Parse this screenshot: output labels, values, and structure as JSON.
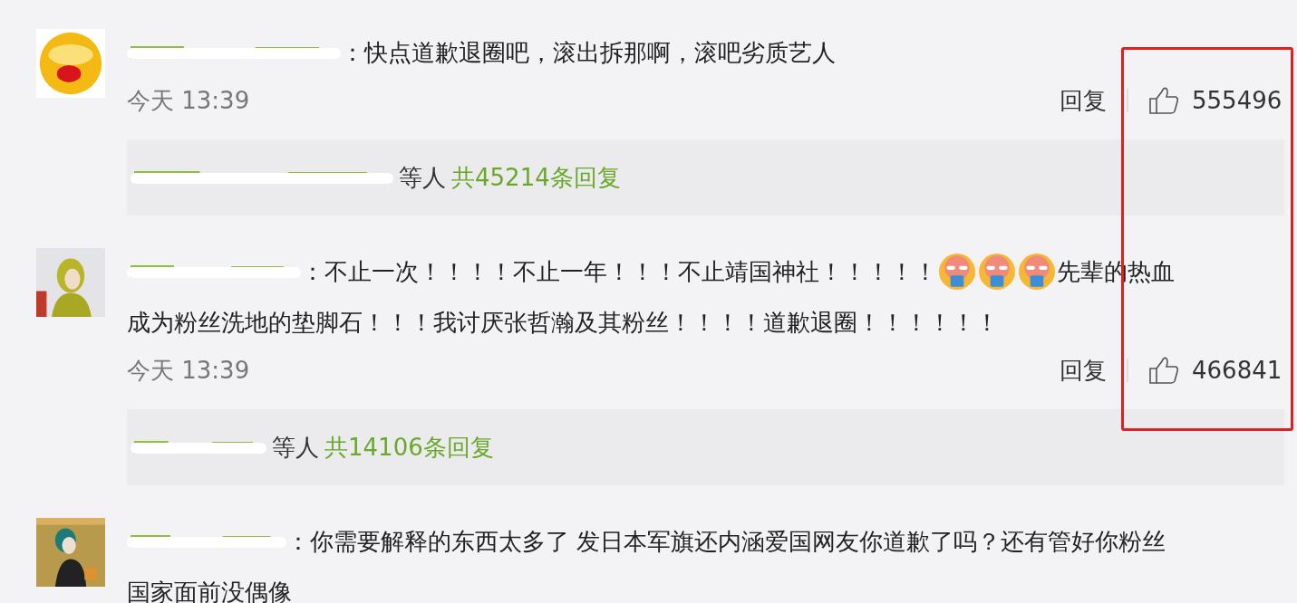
{
  "comments": [
    {
      "avatar": {
        "kind": "picture"
      },
      "lines": [
        [
          {
            "kind": "text",
            "text": "：快点道歉退圈吧，滚出拆那啊，滚吧劣质艺人"
          }
        ]
      ],
      "time": "今天 13:39",
      "reply": "回复",
      "likes": "555496",
      "thread": {
        "tail": "等人",
        "count": "共45214条回复"
      }
    },
    {
      "avatar": {
        "kind": "picture"
      },
      "lines": [
        [
          {
            "kind": "text",
            "text": "：不止一次！！！！不止一年！！！不止靖国神社！！！！！"
          },
          {
            "kind": "emoji"
          },
          {
            "kind": "emoji"
          },
          {
            "kind": "emoji"
          },
          {
            "kind": "text",
            "text": "先辈的热血"
          }
        ],
        [
          {
            "kind": "text",
            "text": "成为粉丝洗地的垫脚石！！！我讨厌张哲瀚及其粉丝！！！！道歉退圈！！！！！！"
          }
        ]
      ],
      "time": "今天 13:39",
      "reply": "回复",
      "likes": "466841",
      "thread": {
        "tail": "等人",
        "count": "共14106条回复"
      }
    },
    {
      "avatar": {
        "kind": "picture"
      },
      "lines": [
        [
          {
            "kind": "text",
            "text": "：你需要解释的东西太多了 发日本军旗还内涵爱国网友你道歉了吗？还有管好你粉丝"
          }
        ],
        [
          {
            "kind": "text",
            "text": "国家面前没偶像"
          }
        ]
      ]
    }
  ],
  "highlight": {
    "on": true
  }
}
